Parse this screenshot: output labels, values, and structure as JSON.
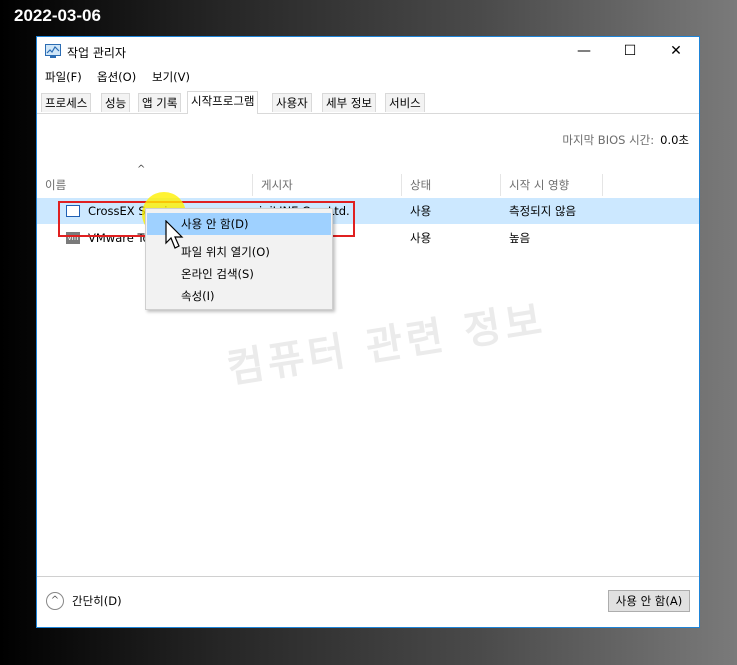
{
  "date_stamp": "2022-03-06",
  "window": {
    "title": "작업 관리자",
    "controls": {
      "minimize": "—",
      "maximize": "☐",
      "close": "✕"
    }
  },
  "menu": [
    "파일(F)",
    "옵션(O)",
    "보기(V)"
  ],
  "tabs": [
    "프로세스",
    "성능",
    "앱 기록",
    "시작프로그램",
    "사용자",
    "세부 정보",
    "서비스"
  ],
  "active_tab": "시작프로그램",
  "bios": {
    "label": "마지막 BIOS 시간:",
    "value": "0.0초"
  },
  "table": {
    "sort_arrow": "^",
    "columns": [
      "이름",
      "게시자",
      "상태",
      "시작 시 영향"
    ],
    "rows": [
      {
        "icon": "crossex-icon",
        "name": "CrossEX Service",
        "publisher": "iniLINE Co., Ltd.",
        "status": "사용",
        "impact": "측정되지 않음"
      },
      {
        "icon": "vmware-icon",
        "icon_text": "vm",
        "name": "VMware Tools",
        "publisher": "",
        "status": "사용",
        "impact": "높음"
      }
    ]
  },
  "context_menu": {
    "items": [
      "사용 안 함(D)",
      "파일 위치 열기(O)",
      "온라인 검색(S)",
      "속성(I)"
    ],
    "highlighted_index": 0
  },
  "watermark": "컴퓨터 관련 정보",
  "footer": {
    "collapse_icon": "^",
    "collapse_label": "간단히(D)",
    "disable_button": "사용 안 함(A)"
  },
  "colors": {
    "accent": "#1e84d8",
    "selected_row": "#cce8ff",
    "menu_highlight": "#9fd1ff",
    "annotation_red": "#e02020",
    "cursor_highlight": "#fff000"
  }
}
